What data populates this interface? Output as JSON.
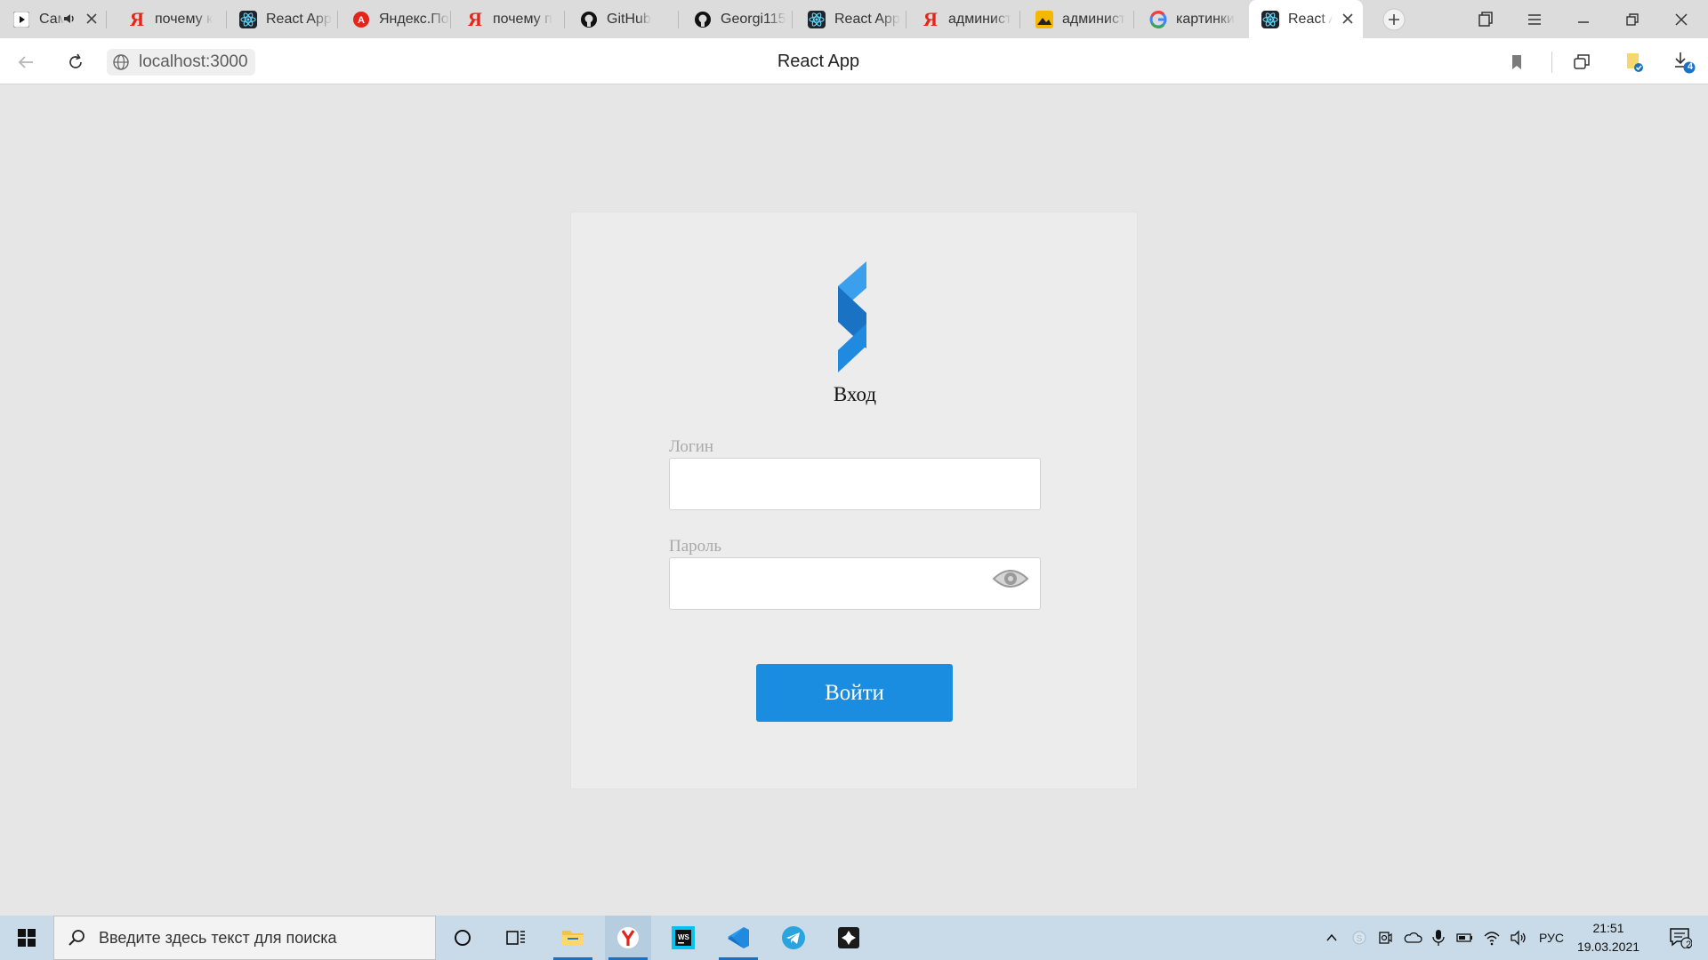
{
  "browser": {
    "tabs": [
      {
        "label": "Сам",
        "icon": "youtube-icon"
      },
      {
        "label": "почему к",
        "icon": "yandex-icon"
      },
      {
        "label": "React App",
        "icon": "react-icon"
      },
      {
        "label": "Яндекс.Почта",
        "icon": "yandex-mail-icon"
      },
      {
        "label": "почему п",
        "icon": "yandex-icon"
      },
      {
        "label": "GitHub",
        "icon": "github-icon"
      },
      {
        "label": "Georgi115",
        "icon": "github-icon"
      },
      {
        "label": "React App",
        "icon": "react-icon"
      },
      {
        "label": "админист",
        "icon": "yandex-icon"
      },
      {
        "label": "админист",
        "icon": "image-icon"
      },
      {
        "label": "картинки",
        "icon": "google-icon"
      },
      {
        "label": "React App",
        "icon": "react-icon"
      }
    ],
    "active_tab_index": 11,
    "url": "localhost:3000",
    "page_title": "React App",
    "download_badge": "4"
  },
  "login": {
    "heading": "Вход",
    "username_label": "Логин",
    "username_value": "",
    "password_label": "Пароль",
    "password_value": "",
    "submit_label": "Войти"
  },
  "colors": {
    "accent": "#1a8de0",
    "logo_light": "#3aa0ee",
    "logo_dark": "#1a72c4"
  },
  "taskbar": {
    "search_placeholder": "Введите здесь текст для поиска",
    "language": "РУС",
    "time": "21:51",
    "date": "19.03.2021",
    "notification_count": "2"
  }
}
